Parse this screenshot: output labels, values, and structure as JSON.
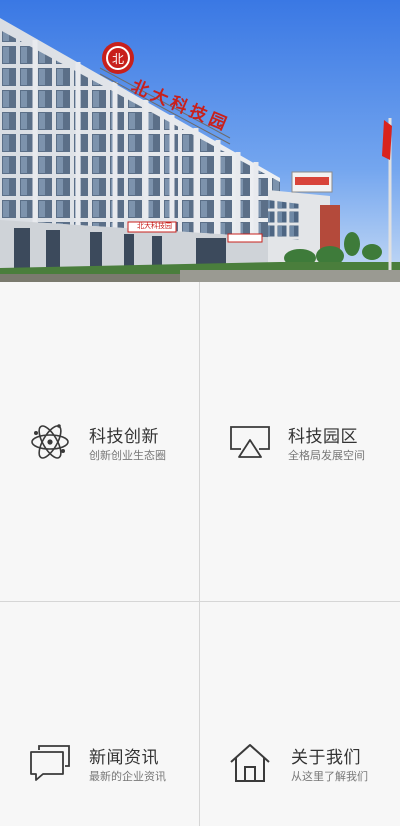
{
  "hero": {
    "sign_text": "北大科技园",
    "side_sign_text": "北大科技园"
  },
  "tiles": [
    {
      "icon": "atom-icon",
      "title": "科技创新",
      "subtitle": "创新创业生态圈"
    },
    {
      "icon": "screen-icon",
      "title": "科技园区",
      "subtitle": "全格局发展空间"
    },
    {
      "icon": "chat-bubbles-icon",
      "title": "新闻资讯",
      "subtitle": "最新的企业资讯"
    },
    {
      "icon": "home-icon",
      "title": "关于我们",
      "subtitle": "从这里了解我们"
    }
  ],
  "colors": {
    "title": "#333333",
    "subtitle": "#777777",
    "divider": "#d6d6d6",
    "background": "#f7f7f7",
    "brand_red": "#c8201c"
  }
}
